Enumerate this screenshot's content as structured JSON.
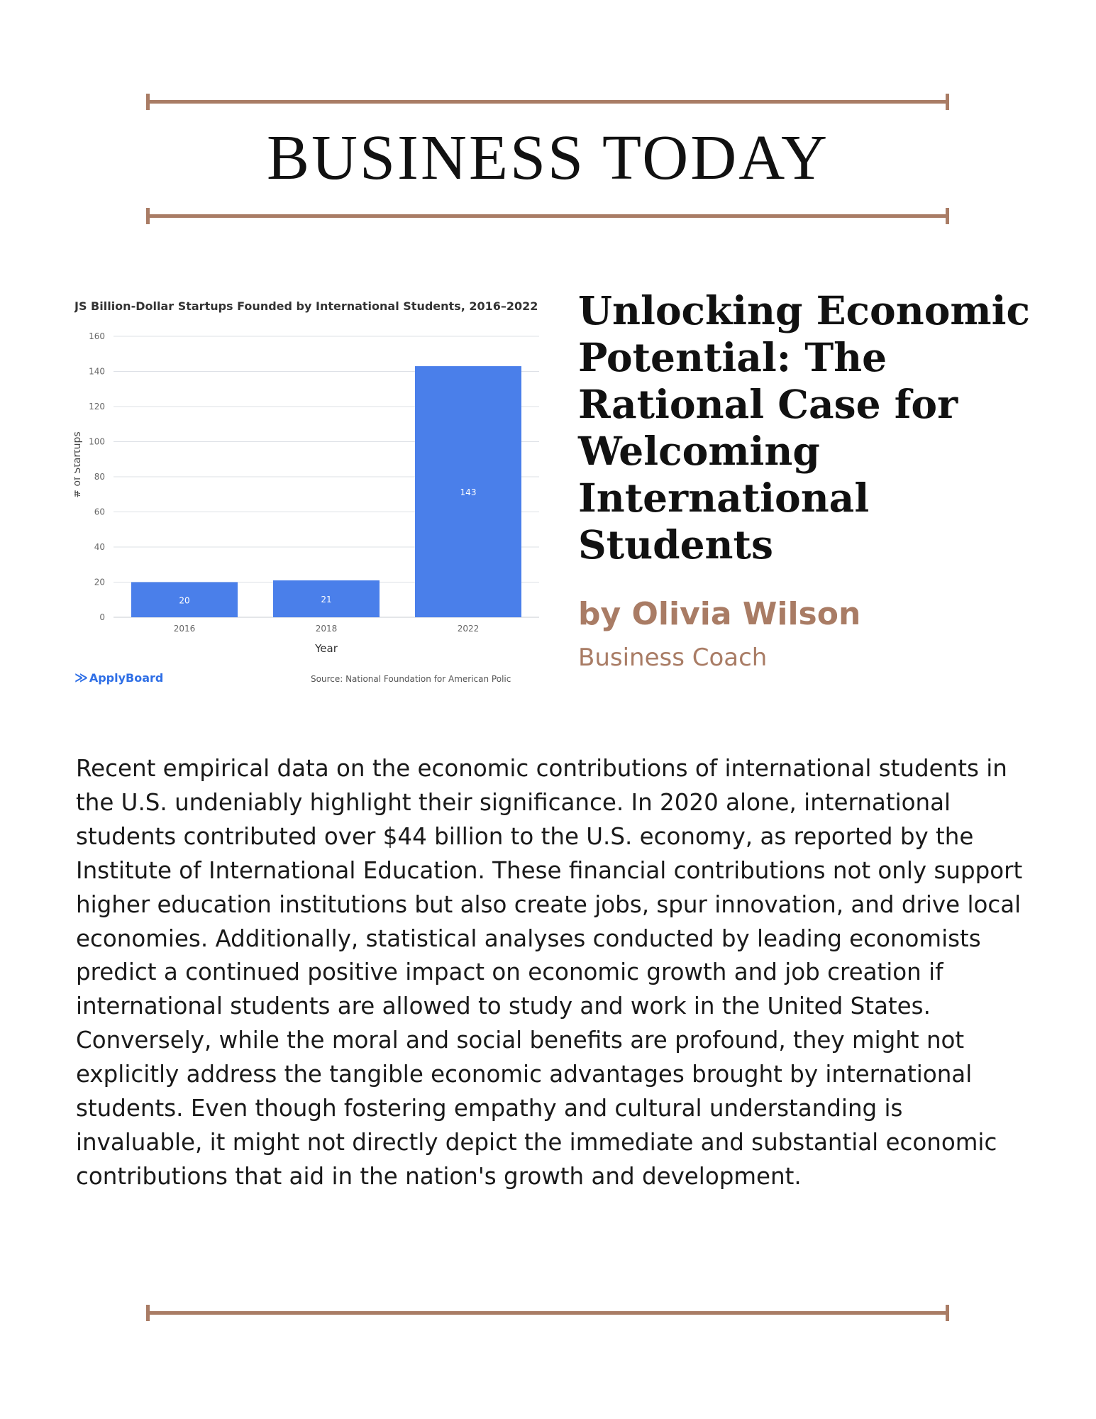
{
  "masthead": "BUSINESS TODAY",
  "article": {
    "headline": "Unlocking Economic Potential: The Rational Case for Welcoming International Students",
    "byline": "by Olivia Wilson",
    "role": "Business Coach",
    "paragraphs": [
      "Recent empirical data on the economic contributions of international students in the U.S. undeniably highlight their significance. In 2020 alone, international students contributed over $44 billion to the U.S. economy, as reported by the Institute of International Education. These financial contributions not only support higher education institutions but also create jobs, spur innovation, and drive local economies. Additionally, statistical analyses conducted by leading economists predict a continued positive impact on economic growth and job creation if international students are allowed to study and work in the United States.",
      "Conversely, while the moral and social benefits are profound, they might not explicitly address the tangible economic advantages brought by international students. Even though fostering empathy and cultural understanding is invaluable, it might not directly depict the immediate and substantial economic contributions that aid in the nation's growth and development."
    ]
  },
  "chart_data": {
    "type": "bar",
    "title": "JS Billion-Dollar Startups Founded by International Students, 2016–2022",
    "xlabel": "Year",
    "ylabel": "# of Startups",
    "categories": [
      "2016",
      "2018",
      "2022"
    ],
    "values": [
      20,
      21,
      143
    ],
    "ylim": [
      0,
      160
    ],
    "yticks": [
      0,
      20,
      40,
      60,
      80,
      100,
      120,
      140,
      160
    ],
    "grid": true,
    "bar_color": "#4a7fea",
    "brand": "ApplyBoard",
    "source": "Source: National Foundation for American Polic"
  },
  "colors": {
    "accent": "#a97c65",
    "text": "#1a1a1a"
  }
}
